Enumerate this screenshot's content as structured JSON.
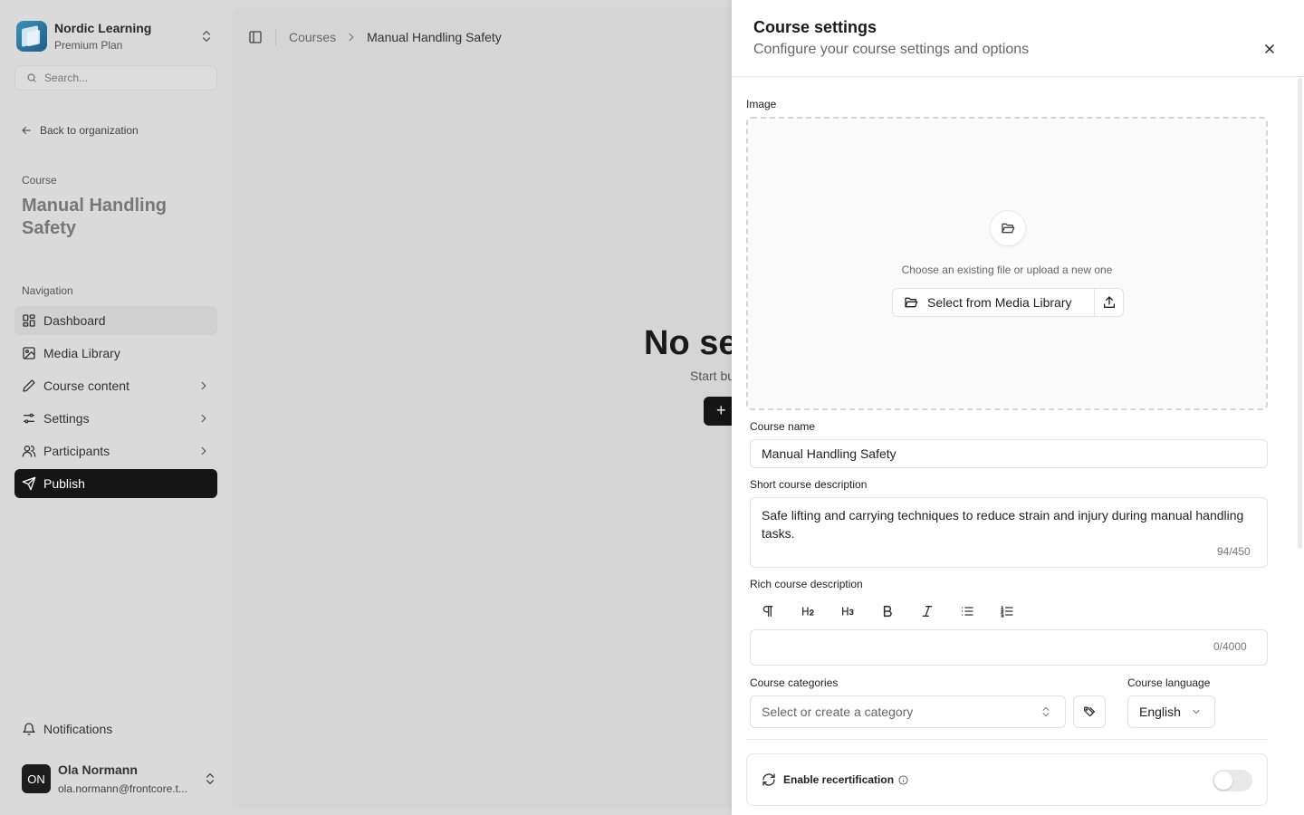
{
  "org": {
    "name": "Nordic Learning",
    "plan": "Premium Plan"
  },
  "search": {
    "placeholder": "Search..."
  },
  "sidebar": {
    "back_label": "Back to organization",
    "course_label": "Course",
    "course_title": "Manual Handling Safety",
    "nav_label": "Navigation",
    "items": [
      {
        "label": "Dashboard",
        "icon": "dashboard-icon",
        "state": "active"
      },
      {
        "label": "Media Library",
        "icon": "image-icon"
      },
      {
        "label": "Course content",
        "icon": "pencil-icon",
        "chevron": true
      },
      {
        "label": "Settings",
        "icon": "sliders-icon",
        "chevron": true
      },
      {
        "label": "Participants",
        "icon": "users-icon",
        "chevron": true
      },
      {
        "label": "Publish",
        "icon": "send-icon",
        "state": "selected"
      }
    ],
    "notifications_label": "Notifications"
  },
  "user": {
    "initials": "ON",
    "name": "Ola Normann",
    "email": "ola.normann@frontcore.t..."
  },
  "breadcrumb": {
    "root": "Courses",
    "current": "Manual Handling Safety"
  },
  "main": {
    "empty_title": "No se",
    "empty_sub": "Start bu",
    "empty_btn": "+"
  },
  "panel": {
    "title": "Course settings",
    "subtitle": "Configure your course settings and options",
    "image_label": "Image",
    "dropzone_text": "Choose an existing file or upload a new one",
    "media_button": "Select from Media Library",
    "course_name_label": "Course name",
    "course_name_value": "Manual Handling Safety",
    "short_desc_label": "Short course description",
    "short_desc_value": "Safe lifting and carrying techniques to reduce strain and injury during manual handling tasks.",
    "short_desc_counter": "94/450",
    "rich_desc_label": "Rich course description",
    "rich_desc_counter": "0/4000",
    "categories_label": "Course categories",
    "categories_placeholder": "Select or create a category",
    "language_label": "Course language",
    "language_value": "English",
    "recert_label": "Enable recertification",
    "recert_enabled": false
  },
  "colors": {
    "dark": "#151515",
    "sidebar_bg": "#dadada",
    "panel_bg": "#ffffff"
  }
}
